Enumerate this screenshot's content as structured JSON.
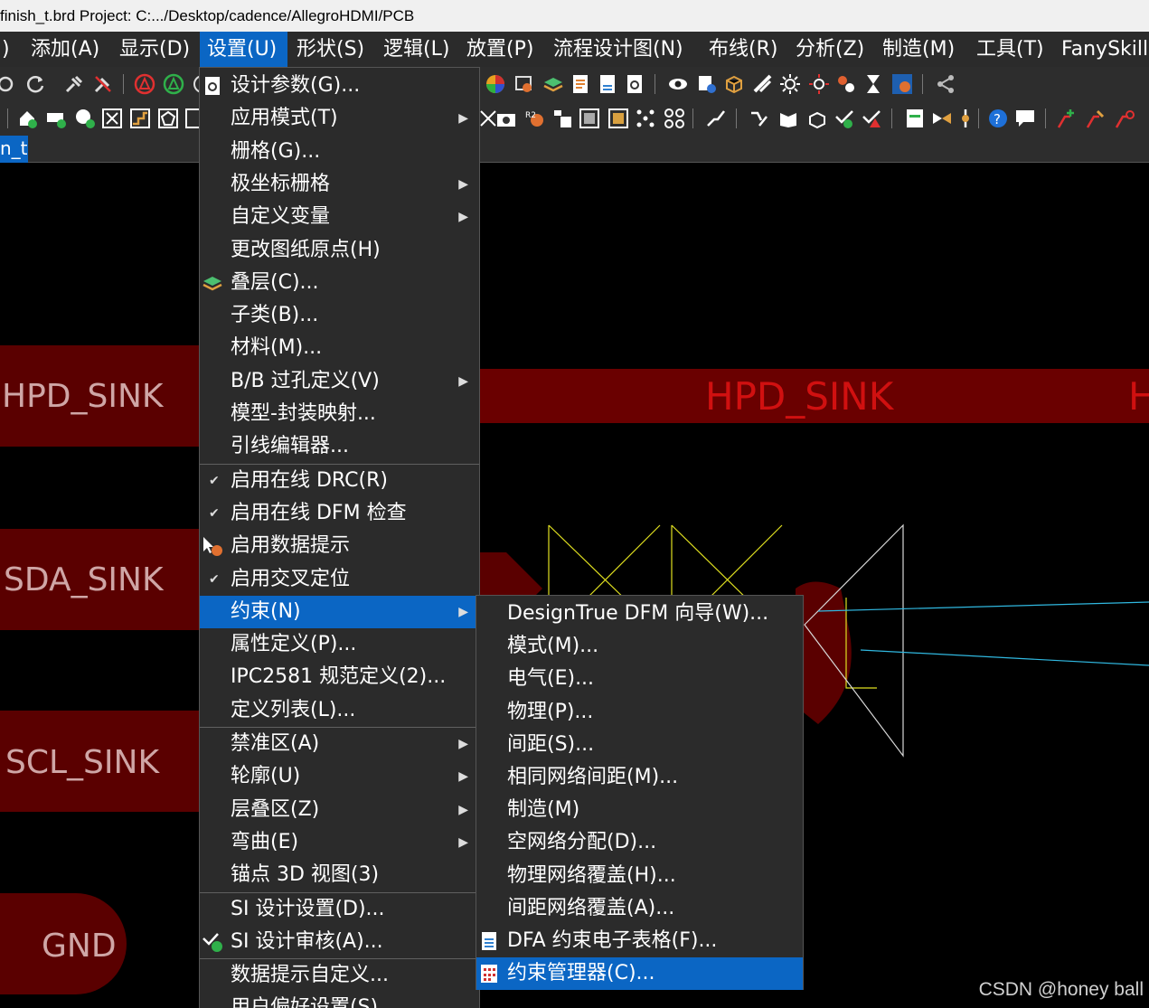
{
  "window": {
    "title": "finish_t.brd  Project: C:.../Desktop/cadence/AllegroHDMI/PCB"
  },
  "menubar": {
    "items": [
      {
        "label": ")"
      },
      {
        "label": "添加(A)"
      },
      {
        "label": "显示(D)"
      },
      {
        "label": "设置(U)"
      },
      {
        "label": "形状(S)"
      },
      {
        "label": "逻辑(L)"
      },
      {
        "label": "放置(P)"
      },
      {
        "label": "流程设计图(N)"
      },
      {
        "label": "布线(R)"
      },
      {
        "label": "分析(Z)"
      },
      {
        "label": "制造(M)"
      },
      {
        "label": "工具(T)"
      },
      {
        "label": "FanySkill"
      }
    ],
    "active_index": 3
  },
  "tabs": {
    "active_label": "n_t"
  },
  "setup_menu": {
    "items": [
      {
        "label": "设计参数(G)...",
        "icon": "design-params-icon"
      },
      {
        "label": "应用模式(T)",
        "submenu": true
      },
      {
        "label": "栅格(G)..."
      },
      {
        "label": "极坐标栅格",
        "submenu": true
      },
      {
        "label": "自定义变量",
        "submenu": true
      },
      {
        "label": "更改图纸原点(H)"
      },
      {
        "label": "叠层(C)...",
        "icon": "stackup-icon"
      },
      {
        "label": "子类(B)..."
      },
      {
        "label": "材料(M)..."
      },
      {
        "label": "B/B 过孔定义(V)",
        "submenu": true
      },
      {
        "label": "模型-封装映射..."
      },
      {
        "label": "引线编辑器...",
        "separator_after": true
      },
      {
        "label": "启用在线 DRC(R)",
        "checked": true
      },
      {
        "label": "启用在线 DFM 检查",
        "checked": true
      },
      {
        "label": "启用数据提示",
        "icon": "datatip-icon"
      },
      {
        "label": "启用交叉定位",
        "checked": true
      },
      {
        "label": "约束(N)",
        "submenu": true,
        "highlighted": true
      },
      {
        "label": "属性定义(P)..."
      },
      {
        "label": "IPC2581 规范定义(2)..."
      },
      {
        "label": "定义列表(L)...",
        "separator_after": true
      },
      {
        "label": "禁准区(A)",
        "submenu": true
      },
      {
        "label": "轮廓(U)",
        "submenu": true
      },
      {
        "label": "层叠区(Z)",
        "submenu": true
      },
      {
        "label": "弯曲(E)",
        "submenu": true
      },
      {
        "label": "锚点 3D 视图(3)",
        "separator_after": true
      },
      {
        "label": "SI 设计设置(D)..."
      },
      {
        "label": "SI 设计审核(A)...",
        "icon": "si-audit-icon",
        "separator_after": true
      },
      {
        "label": "数据提示自定义..."
      },
      {
        "label": "用户偏好设置(S)..."
      }
    ]
  },
  "constraints_submenu": {
    "items": [
      {
        "label": "DesignTrue DFM 向导(W)..."
      },
      {
        "label": "模式(M)..."
      },
      {
        "label": "电气(E)..."
      },
      {
        "label": "物理(P)..."
      },
      {
        "label": "间距(S)..."
      },
      {
        "label": "相同网络间距(M)..."
      },
      {
        "label": "制造(M)"
      },
      {
        "label": "空网络分配(D)..."
      },
      {
        "label": "物理网络覆盖(H)..."
      },
      {
        "label": "间距网络覆盖(A)..."
      },
      {
        "label": "DFA 约束电子表格(F)...",
        "icon": "spreadsheet-icon"
      },
      {
        "label": "约束管理器(C)...",
        "icon": "constraint-manager-icon",
        "highlighted": true
      }
    ]
  },
  "canvas": {
    "pins": [
      {
        "label": "HPD_SINK"
      },
      {
        "label": "HPD_SINK"
      },
      {
        "label": "H"
      },
      {
        "label": "SDA_SINK"
      },
      {
        "label": "SCL_SINK"
      },
      {
        "label": "GND"
      }
    ]
  },
  "watermark": "CSDN @honey ball",
  "colors": {
    "accent": "#0b66c4",
    "menu_bg": "#2b2b2b",
    "pin_band": "#5a0000",
    "net_red": "#c00000"
  }
}
